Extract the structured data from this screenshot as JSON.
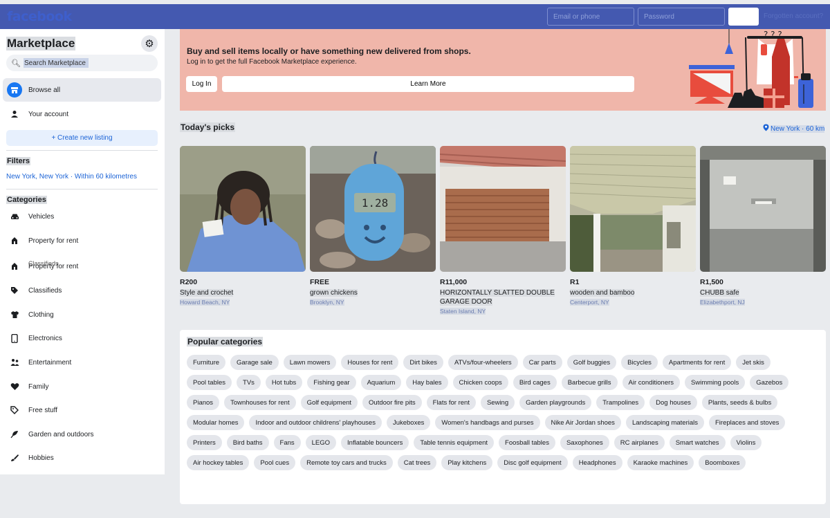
{
  "topbar": {
    "logo": "facebook",
    "email_placeholder": "Email or phone",
    "password_placeholder": "Password",
    "forgot_text": "Forgotten account?"
  },
  "sidebar": {
    "title": "Marketplace",
    "search_placeholder": "Search Marketplace",
    "nav": [
      {
        "label": "Browse all",
        "icon": "storefront-icon"
      },
      {
        "label": "Your account",
        "icon": "person-icon"
      }
    ],
    "create_listing": "+ Create new listing",
    "filters_heading": "Filters",
    "filters_location": "New York, New York · Within 60 kilometres",
    "categories_heading": "Categories",
    "categories": [
      {
        "label": "Vehicles",
        "icon": "car-icon"
      },
      {
        "label": "Property for rent",
        "icon": "house-icon"
      },
      {
        "label": "Property for rent",
        "ghost": "Classifieds",
        "icon": "house-icon"
      },
      {
        "label": "Classifieds",
        "icon": "tag-icon"
      },
      {
        "label": "Clothing",
        "icon": "shirt-icon"
      },
      {
        "label": "Electronics",
        "icon": "phone-icon"
      },
      {
        "label": "Entertainment",
        "icon": "people-icon"
      },
      {
        "label": "Family",
        "icon": "heart-icon"
      },
      {
        "label": "Free stuff",
        "icon": "tag-icon"
      },
      {
        "label": "Garden and outdoors",
        "icon": "plant-icon"
      },
      {
        "label": "Hobbies",
        "icon": "brush-icon"
      }
    ]
  },
  "banner": {
    "title": "Buy and sell items locally or have something new delivered from shops.",
    "subtitle": "Log in to get the full Facebook Marketplace experience.",
    "login_label": "Log In",
    "learn_more_label": "Learn More",
    "colors": {
      "background": "#f0b6aa"
    }
  },
  "picks": {
    "title": "Today's picks",
    "location": "New York · 60 km",
    "items": [
      {
        "price": "R200",
        "title": "Style and crochet",
        "location": "Howard Beach, NY"
      },
      {
        "price": "FREE",
        "title": "grown chickens",
        "location": "Brooklyn, NY"
      },
      {
        "price": "R11,000",
        "title": "HORIZONTALLY SLATTED DOUBLE GARAGE DOOR",
        "location": "Staten Island, NY"
      },
      {
        "price": "R1",
        "title": "wooden and bamboo",
        "location": "Centerport, NY"
      },
      {
        "price": "R1,500",
        "title": "CHUBB safe",
        "location": "Elizabethport, NJ"
      }
    ]
  },
  "popular": {
    "title": "Popular categories",
    "chips": [
      "Furniture",
      "Garage sale",
      "Lawn mowers",
      "Houses for rent",
      "Dirt bikes",
      "ATVs/four-wheelers",
      "Car parts",
      "Golf buggies",
      "Bicycles",
      "Apartments for rent",
      "Jet skis",
      "Pool tables",
      "TVs",
      "Hot tubs",
      "Fishing gear",
      "Aquarium",
      "Hay bales",
      "Chicken coops",
      "Bird cages",
      "Barbecue grills",
      "Air conditioners",
      "Swimming pools",
      "Gazebos",
      "Pianos",
      "Townhouses for rent",
      "Golf equipment",
      "Outdoor fire pits",
      "Flats for rent",
      "Sewing",
      "Garden playgrounds",
      "Trampolines",
      "Dog houses",
      "Plants, seeds & bulbs",
      "Modular homes",
      "Indoor and outdoor childrens' playhouses",
      "Jukeboxes",
      "Women's handbags and purses",
      "Nike Air Jordan shoes",
      "Landscaping materials",
      "Fireplaces and stoves",
      "Printers",
      "Bird baths",
      "Fans",
      "LEGO",
      "Inflatable bouncers",
      "Table tennis equipment",
      "Foosball tables",
      "Saxophones",
      "RC airplanes",
      "Smart watches",
      "Violins",
      "Air hockey tables",
      "Pool cues",
      "Remote toy cars and trucks",
      "Cat trees",
      "Play kitchens",
      "Disc golf equipment",
      "Headphones",
      "Karaoke machines",
      "Boomboxes"
    ]
  },
  "colors": {
    "topbar": "#4459b0",
    "accent": "#1877f2",
    "link": "#1b63d6"
  }
}
